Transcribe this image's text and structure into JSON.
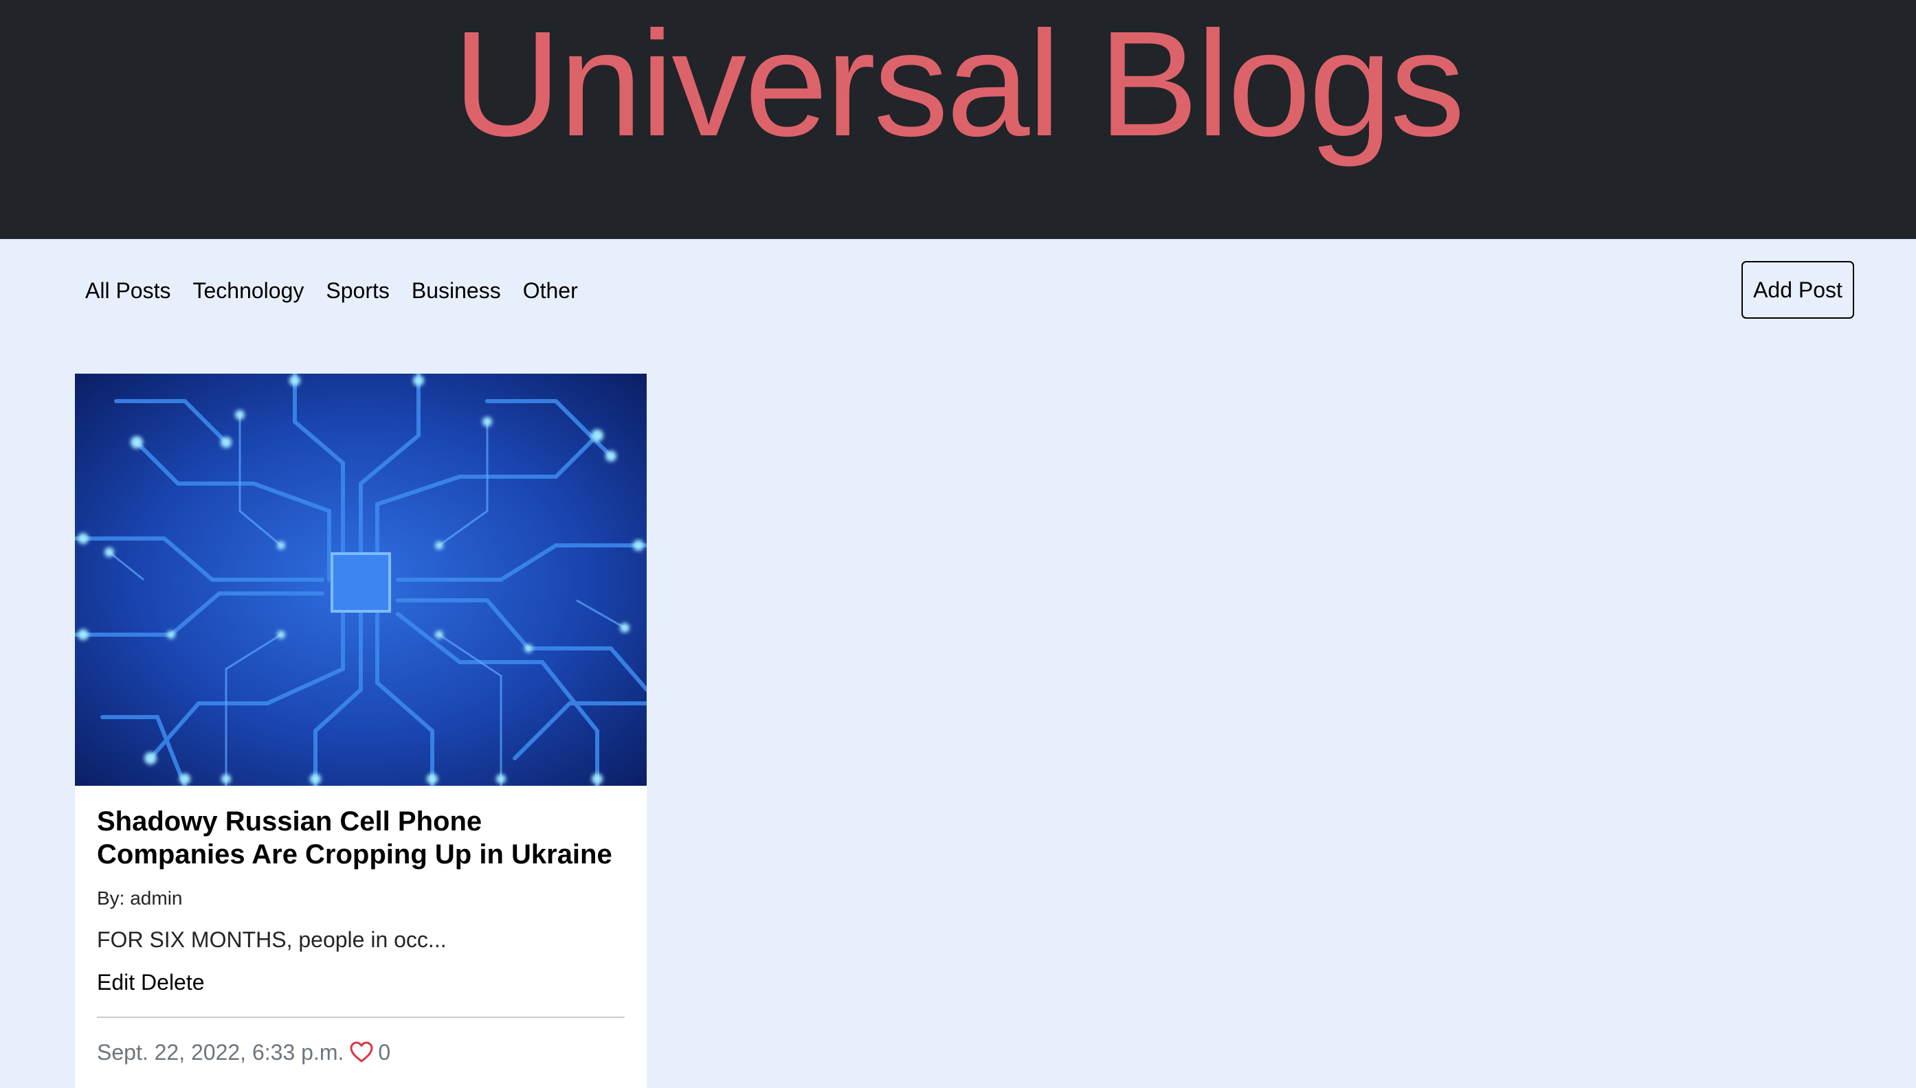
{
  "header": {
    "title": "Universal Blogs"
  },
  "nav": {
    "items": [
      {
        "label": "All Posts"
      },
      {
        "label": "Technology"
      },
      {
        "label": "Sports"
      },
      {
        "label": "Business"
      },
      {
        "label": "Other"
      }
    ],
    "add_post_label": "Add Post"
  },
  "posts": [
    {
      "image_icon": "circuit-board-image",
      "title": "Shadowy Russian Cell Phone Companies Are Cropping Up in Ukraine",
      "author": "By: admin",
      "excerpt": "FOR SIX MONTHS, people in occ...",
      "edit_label": "Edit",
      "delete_label": "Delete",
      "date": "Sept. 22, 2022, 6:33 p.m.",
      "likes_icon": "heart-icon",
      "likes": "0"
    }
  ],
  "colors": {
    "header_bg": "#212429",
    "title": "#dd636a",
    "page_bg": "#e8effc",
    "card_bg": "#ffffff",
    "meta_text": "#6c757d",
    "heart": "#dc3545"
  }
}
